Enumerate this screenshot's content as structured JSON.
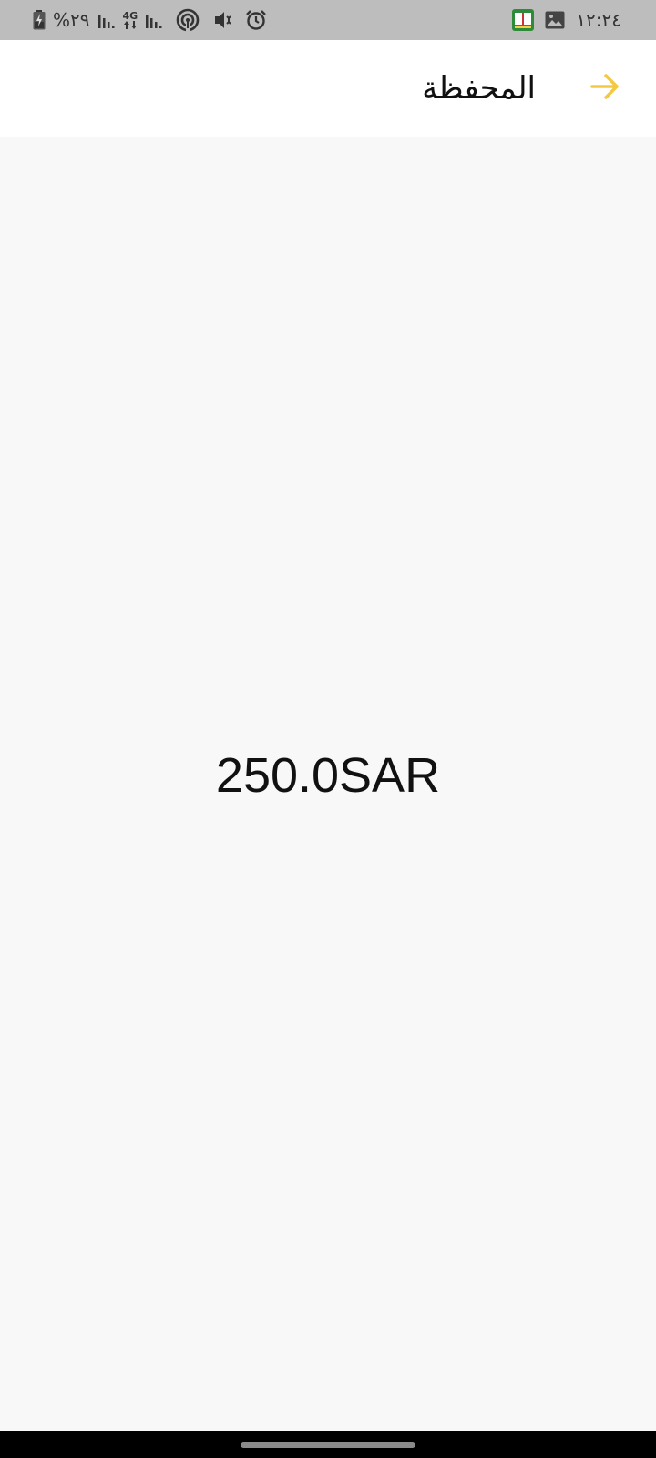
{
  "status_bar": {
    "battery_percent": "%٢٩",
    "network_type": "4G",
    "time": "١٢:٢٤",
    "icons_left": [
      "battery-charging-icon",
      "signal-icon",
      "data-4g-icon",
      "signal-icon",
      "hotspot-icon",
      "mute-icon",
      "alarm-icon"
    ],
    "icons_right": [
      "app-notification-icon",
      "image-icon"
    ]
  },
  "header": {
    "title": "المحفظة",
    "back_icon": "arrow-right-icon",
    "accent_color": "#f5c842"
  },
  "wallet": {
    "balance": "250.0SAR"
  }
}
